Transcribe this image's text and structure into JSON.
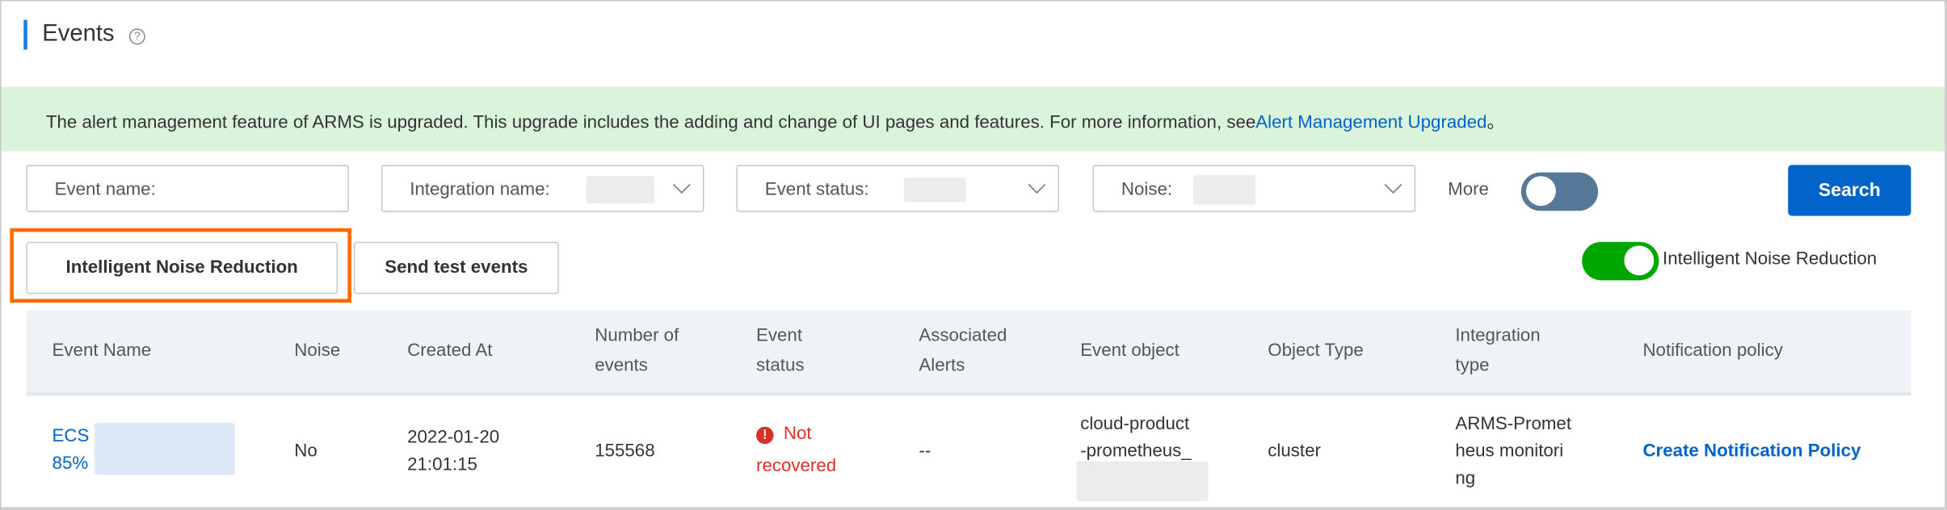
{
  "page": {
    "title": "Events",
    "help_icon": "question-circle-icon"
  },
  "banner": {
    "text": "The alert management feature of ARMS is upgraded. This upgrade includes the adding and change of UI pages and features. For more information, see",
    "link": "Alert Management Upgraded",
    "suffix": "。"
  },
  "filters": {
    "event_name": "Event name:",
    "integration_name": "Integration name:",
    "event_status": "Event status:",
    "noise": "Noise:",
    "more_label": "More",
    "more_toggle_on": false,
    "search_label": "Search"
  },
  "actions": {
    "intelligent_noise_reduction": "Intelligent Noise Reduction",
    "send_test_events": "Send test events",
    "noise_toggle_label": "Intelligent Noise Reduction",
    "noise_toggle_on": true
  },
  "colors": {
    "accent": "#0064c8",
    "toggle_on": "#00a700",
    "toggle_off": "#587899",
    "highlight": "#ff6a00",
    "error": "#d93026",
    "banner_bg": "#d9f4da"
  },
  "table": {
    "columns": [
      "Event Name",
      "Noise",
      "Created At",
      "Number of events",
      "Event status",
      "Associated Alerts",
      "Event object",
      "Object Type",
      "Integration type",
      "Notification policy"
    ],
    "rows": [
      {
        "event_name_prefix": "ECS",
        "event_name_suffix": "85%",
        "noise": "No",
        "created_date": "2022-01-20",
        "created_time": "21:01:15",
        "number_of_events": "155568",
        "status_line1": "Not",
        "status_line2": "recovered",
        "associated_alerts": "--",
        "event_object_line1": "cloud-product",
        "event_object_line2": "-prometheus_",
        "object_type": "cluster",
        "integration_line1": "ARMS-Promet",
        "integration_line2": "heus monitori",
        "integration_line3": "ng",
        "notification_policy": "Create Notification Policy"
      }
    ]
  }
}
